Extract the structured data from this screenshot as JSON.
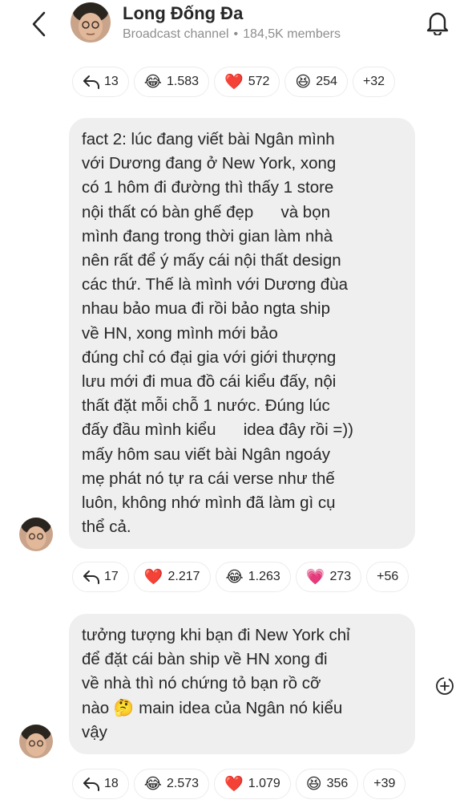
{
  "header": {
    "channel_name": "Long Đống Đa",
    "channel_type": "Broadcast channel",
    "separator": "•",
    "members": "184,5K members"
  },
  "reactions_top": {
    "replies": "13",
    "items": [
      {
        "emoji": "😂",
        "count": "1.583"
      },
      {
        "emoji": "❤️",
        "count": "572"
      },
      {
        "emoji": "😆",
        "count": "254"
      }
    ],
    "more": "+32"
  },
  "message_1": {
    "lines": [
      "fact 2: lúc đang viết bài Ngân mình",
      "với Dương đang ở New York, xong",
      "có 1 hôm đi đường thì thấy 1 store",
      "nội thất có bàn ghế đẹp      và bọn",
      "mình đang trong thời gian làm nhà",
      "nên rất để ý mấy cái nội thất design",
      "các thứ. Thế là mình với Dương đùa",
      "nhau bảo mua đi rồi bảo ngta ship",
      "về HN, xong mình mới bảo",
      "đúng chỉ có đại gia với giới thượng",
      "lưu mới đi mua đồ cái kiểu đấy, nội",
      "thất đặt mỗi chỗ 1 nước. Đúng lúc",
      "đấy đầu mình kiểu      idea đây rồi =))",
      "mấy hôm sau viết bài Ngân ngoáy",
      "mẹ phát nó tự ra cái verse như thế",
      "luôn, không nhớ mình đã làm gì cụ",
      "thể cả."
    ]
  },
  "reactions_1": {
    "replies": "17",
    "items": [
      {
        "emoji": "❤️",
        "count": "2.217"
      },
      {
        "emoji": "😂",
        "count": "1.263"
      },
      {
        "emoji": "💗",
        "count": "273"
      }
    ],
    "more": "+56"
  },
  "message_2": {
    "lines": [
      "tưởng tượng khi bạn đi New York chỉ",
      "để đặt cái bàn ship về HN xong đi",
      "về nhà thì nó chứng tỏ bạn rồ cỡ",
      "nào 🤔 main idea của Ngân nó kiểu",
      "vậy"
    ]
  },
  "reactions_2": {
    "replies": "18",
    "items": [
      {
        "emoji": "😂",
        "count": "2.573"
      },
      {
        "emoji": "❤️",
        "count": "1.079"
      },
      {
        "emoji": "😆",
        "count": "356"
      }
    ],
    "more": "+39"
  },
  "icons": {
    "back": "chevron-left-icon",
    "bell": "bell-icon",
    "reply": "reply-arrow-icon",
    "add_reaction": "add-reaction-icon"
  }
}
